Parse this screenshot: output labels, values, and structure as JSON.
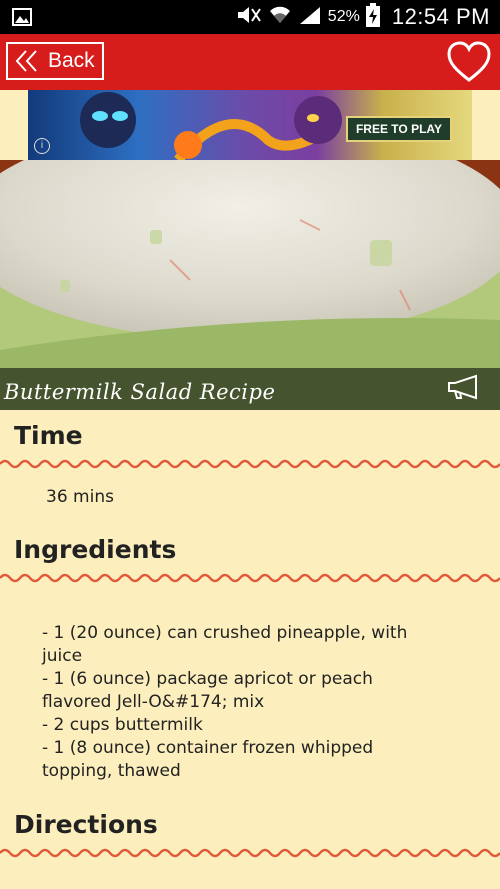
{
  "status_bar": {
    "battery_percent": "52%",
    "time": "12:54 PM"
  },
  "app_bar": {
    "back_label": "Back"
  },
  "ad": {
    "cta_label": "FREE TO PLAY",
    "info_icon": "i"
  },
  "recipe": {
    "title": "Buttermilk Salad Recipe"
  },
  "sections": {
    "time_heading": "Time",
    "time_value": "36 mins",
    "ingredients_heading": "Ingredients",
    "ingredients": [
      " -  1 (20 ounce) can crushed pineapple, with",
      "juice",
      " -  1 (6 ounce) package apricot or peach",
      "flavored Jell-O&#174; mix",
      " -  2 cups buttermilk",
      " -  1 (8 ounce) container frozen whipped",
      "topping, thawed"
    ],
    "directions_heading": "Directions"
  },
  "colors": {
    "app_bar": "#d71c1c",
    "background": "#fcefbd",
    "wave": "#e05a3a"
  }
}
